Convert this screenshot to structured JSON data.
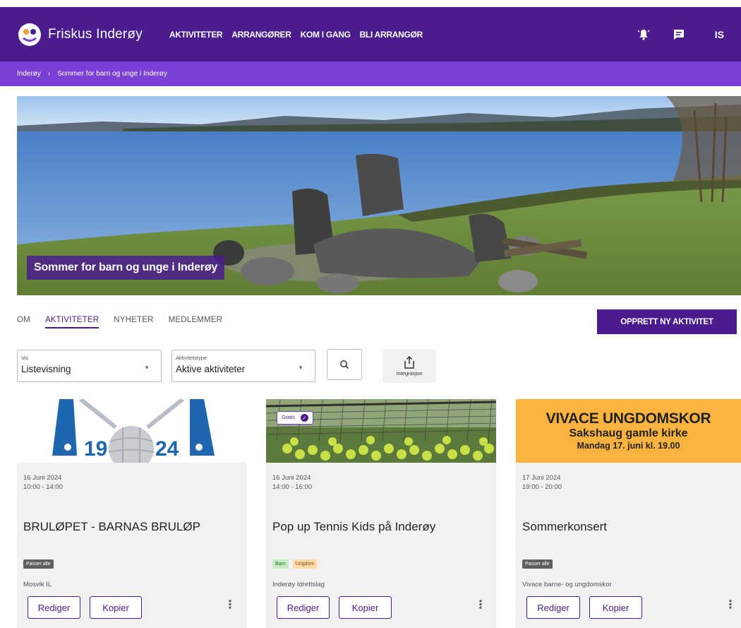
{
  "header": {
    "brand": "Friskus Inderøy",
    "nav": [
      "AKTIVITETER",
      "ARRANGØRER",
      "KOM I GANG",
      "BLI ARRANGØR"
    ],
    "user_initials": "IS",
    "icons": [
      "notification-bell-icon",
      "message-icon"
    ]
  },
  "breadcrumb": {
    "root": "Inderøy",
    "separator": "›",
    "current": "Sommer for barn og unge i Inderøy"
  },
  "hero": {
    "title": "Sommer for barn og unge i Inderøy"
  },
  "tabs": [
    "OM",
    "AKTIVITETER",
    "NYHETER",
    "MEDLEMMER"
  ],
  "create_button": "OPPRETT NY AKTIVITET",
  "filters": {
    "view_label": "Vis",
    "view_value": "Listevisning",
    "type_label": "Aktivitetstype",
    "type_value": "Aktive aktiviteter",
    "integration_label": "Integrasjon"
  },
  "cards": [
    {
      "image_text_left": "19",
      "image_text_right": "24",
      "date": "16 Juni 2024",
      "time": "10:00 - 14:00",
      "title": "BRULØPET - BARNAS BRULØP",
      "badges": [
        "Passer alle"
      ],
      "organizer": "Mosvik IL",
      "edit": "Rediger",
      "copy": "Kopier"
    },
    {
      "price_tag": "Gratis",
      "date": "16 Juni 2024",
      "time": "14:00 - 16:00",
      "title": "Pop up Tennis Kids på Inderøy",
      "badges": [
        "Barn",
        "Ungdom"
      ],
      "organizer": "Inderøy Idrettslag",
      "edit": "Rediger",
      "copy": "Kopier"
    },
    {
      "poster_line1": "VIVACE UNGDOMSKOR",
      "poster_line2": "Sakshaug gamle kirke",
      "poster_line3": "Mandag 17. juni kl. 19.00",
      "date": "17 Juni 2024",
      "time": "19:00 - 20:00",
      "title": "Sommerkonsert",
      "badges": [
        "Passer alle"
      ],
      "organizer": "Vivace barne- og ungdomskor",
      "edit": "Rediger",
      "copy": "Kopier"
    }
  ],
  "colors": {
    "primary": "#4a1c8e",
    "breadcrumb_bg": "#7a3fd4",
    "poster_orange": "#fbb33f"
  }
}
